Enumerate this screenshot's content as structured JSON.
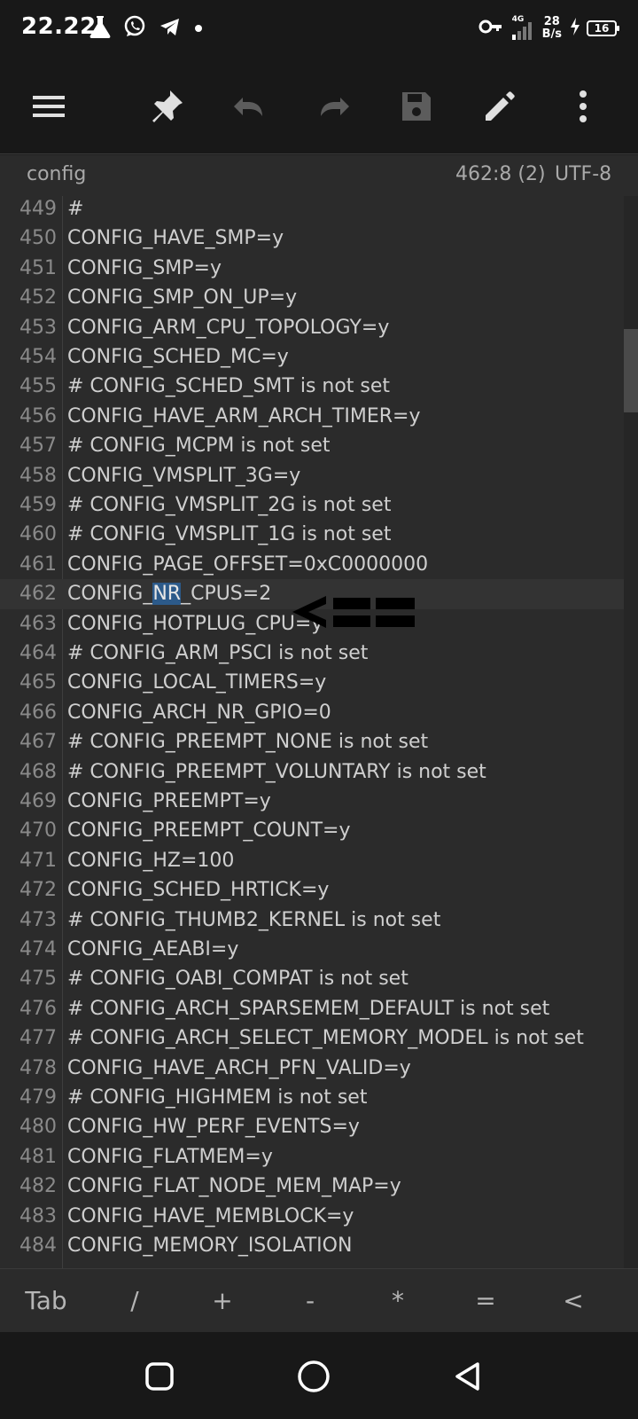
{
  "status_bar": {
    "time": "22.22",
    "network_type": "4G",
    "speed_value": "28",
    "speed_unit": "B/s",
    "battery_level": "16"
  },
  "toolbar": {
    "icons": [
      "menu-icon",
      "pin-icon",
      "undo-icon",
      "redo-icon",
      "save-icon",
      "edit-icon",
      "more-vert-icon"
    ]
  },
  "info_bar": {
    "filename": "config",
    "cursor_position": "462:8 (2)",
    "encoding": "UTF-8"
  },
  "editor": {
    "current_line": "462",
    "selected_text": "NR",
    "lines": [
      {
        "n": "449",
        "text": "#"
      },
      {
        "n": "450",
        "text": "CONFIG_HAVE_SMP=y"
      },
      {
        "n": "451",
        "text": "CONFIG_SMP=y"
      },
      {
        "n": "452",
        "text": "CONFIG_SMP_ON_UP=y"
      },
      {
        "n": "453",
        "text": "CONFIG_ARM_CPU_TOPOLOGY=y"
      },
      {
        "n": "454",
        "text": "CONFIG_SCHED_MC=y"
      },
      {
        "n": "455",
        "text": "# CONFIG_SCHED_SMT is not set"
      },
      {
        "n": "456",
        "text": "CONFIG_HAVE_ARM_ARCH_TIMER=y"
      },
      {
        "n": "457",
        "text": "# CONFIG_MCPM is not set"
      },
      {
        "n": "458",
        "text": "CONFIG_VMSPLIT_3G=y"
      },
      {
        "n": "459",
        "text": "# CONFIG_VMSPLIT_2G is not set"
      },
      {
        "n": "460",
        "text": "# CONFIG_VMSPLIT_1G is not set"
      },
      {
        "n": "461",
        "text": "CONFIG_PAGE_OFFSET=0xC0000000"
      },
      {
        "n": "462",
        "text": "CONFIG_NR_CPUS=2",
        "pre": "CONFIG_",
        "sel": "NR",
        "post": "_CPUS=2"
      },
      {
        "n": "463",
        "text": "CONFIG_HOTPLUG_CPU=y"
      },
      {
        "n": "464",
        "text": "# CONFIG_ARM_PSCI is not set"
      },
      {
        "n": "465",
        "text": "CONFIG_LOCAL_TIMERS=y"
      },
      {
        "n": "466",
        "text": "CONFIG_ARCH_NR_GPIO=0"
      },
      {
        "n": "467",
        "text": "# CONFIG_PREEMPT_NONE is not set"
      },
      {
        "n": "468",
        "text": "# CONFIG_PREEMPT_VOLUNTARY is not set"
      },
      {
        "n": "469",
        "text": "CONFIG_PREEMPT=y"
      },
      {
        "n": "470",
        "text": "CONFIG_PREEMPT_COUNT=y"
      },
      {
        "n": "471",
        "text": "CONFIG_HZ=100"
      },
      {
        "n": "472",
        "text": "CONFIG_SCHED_HRTICK=y"
      },
      {
        "n": "473",
        "text": "# CONFIG_THUMB2_KERNEL is not set"
      },
      {
        "n": "474",
        "text": "CONFIG_AEABI=y"
      },
      {
        "n": "475",
        "text": "# CONFIG_OABI_COMPAT is not set"
      },
      {
        "n": "476",
        "text": "# CONFIG_ARCH_SPARSEMEM_DEFAULT is not set"
      },
      {
        "n": "477",
        "text": "# CONFIG_ARCH_SELECT_MEMORY_MODEL is not set"
      },
      {
        "n": "478",
        "text": "CONFIG_HAVE_ARCH_PFN_VALID=y"
      },
      {
        "n": "479",
        "text": "# CONFIG_HIGHMEM is not set"
      },
      {
        "n": "480",
        "text": "CONFIG_HW_PERF_EVENTS=y"
      },
      {
        "n": "481",
        "text": "CONFIG_FLATMEM=y"
      },
      {
        "n": "482",
        "text": "CONFIG_FLAT_NODE_MEM_MAP=y"
      },
      {
        "n": "483",
        "text": "CONFIG_HAVE_MEMBLOCK=y"
      },
      {
        "n": "484",
        "text": "CONFIG_MEMORY_ISOLATION"
      }
    ]
  },
  "key_bar": {
    "keys": [
      "Tab",
      "/",
      "+",
      "-",
      "*",
      "=",
      "<"
    ]
  },
  "nav_bar": {
    "icons": [
      "recents-square-icon",
      "home-circle-icon",
      "back-triangle-icon"
    ]
  },
  "colors": {
    "background": "#202020",
    "editor_bg": "#2b2b2b",
    "selection": "#2c5a8a",
    "text": "#cfcfcf",
    "line_number": "#8a8a8a"
  }
}
